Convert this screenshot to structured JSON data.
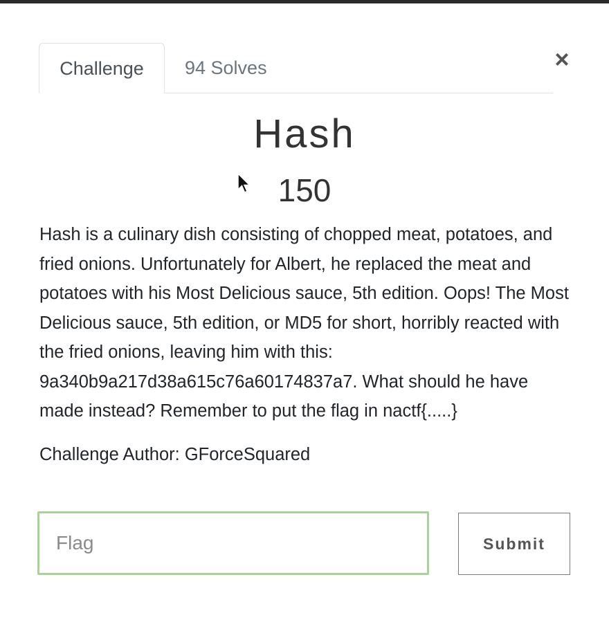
{
  "modal": {
    "tabs": [
      {
        "label": "Challenge",
        "active": true
      },
      {
        "label": "94 Solves",
        "active": false
      }
    ],
    "close_glyph": "×"
  },
  "challenge": {
    "title": "Hash",
    "points": "150",
    "description": "Hash is a culinary dish consisting of chopped meat, potatoes, and fried onions. Unfortunately for Albert, he replaced the meat and potatoes with his Most Delicious sauce, 5th edition. Oops! The Most Delicious sauce, 5th edition, or MD5 for short, horribly reacted with the fried onions, leaving him with this: 9a340b9a217d38a615c76a60174837a7. What should he have made instead? Remember to put the flag in nactf{.....}",
    "author": "Challenge Author: GForceSquared"
  },
  "form": {
    "flag_placeholder": "Flag",
    "flag_value": "",
    "submit_label": "Submit"
  },
  "colors": {
    "input_focus_border": "#a8d29a",
    "topbar": "#2b2b2b"
  }
}
